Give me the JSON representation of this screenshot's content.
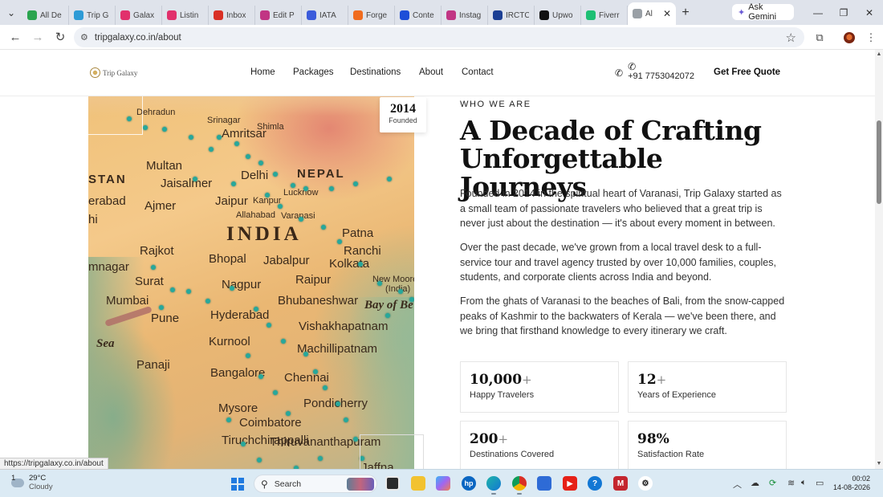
{
  "browser": {
    "tabs": [
      {
        "label": "All De",
        "color": "#2aa44f"
      },
      {
        "label": "Trip G",
        "color": "#2e9bd6"
      },
      {
        "label": "Galax",
        "color": "#e1306c"
      },
      {
        "label": "Listin",
        "color": "#e1306c"
      },
      {
        "label": "Inbox",
        "color": "#d93025"
      },
      {
        "label": "Edit P",
        "color": "#c13584"
      },
      {
        "label": "IATA",
        "color": "#3b5bdb"
      },
      {
        "label": "Forge",
        "color": "#f06c1f"
      },
      {
        "label": "Conte",
        "color": "#1d4ed8"
      },
      {
        "label": "Instag",
        "color": "#c13584"
      },
      {
        "label": "IRCTC",
        "color": "#1c3f94"
      },
      {
        "label": "Upwo",
        "color": "#111111"
      },
      {
        "label": "Fiverr",
        "color": "#1dbf73"
      },
      {
        "label": "Al",
        "color": "#9aa0a6"
      }
    ],
    "gemini_label": "Ask Gemini",
    "url": "tripgalaxy.co.in/about",
    "status_url": "https://tripgalaxy.co.in/about"
  },
  "site": {
    "logo_text": "Trip Galaxy",
    "nav": [
      "Home",
      "Packages",
      "Destinations",
      "About",
      "Contact"
    ],
    "phone": "+91 7753042072",
    "cta": "Get Free Quote",
    "founded_year": "2014",
    "founded_label": "Founded",
    "eyebrow": "WHO WE ARE",
    "headline": "A Decade of Crafting Unforgettable Journeys",
    "paragraphs": [
      "Founded in 2014 in the spiritual heart of Varanasi, Trip Galaxy started as a small team of passionate travelers who believed that a great trip is never just about the destination — it's about every moment in between.",
      "Over the past decade, we've grown from a local travel desk to a full-service tour and travel agency trusted by over 10,000 families, couples, students, and corporate clients across India and beyond.",
      "From the ghats of Varanasi to the beaches of Bali, from the snow-capped peaks of Kashmir to the backwaters of Kerala — we've been there, and we bring that firsthand knowledge to every itinerary we craft."
    ],
    "stats": [
      {
        "value": "10,000",
        "suffix": "+",
        "label": "Happy Travelers"
      },
      {
        "value": "12",
        "suffix": "+",
        "label": "Years of Experience"
      },
      {
        "value": "200",
        "suffix": "+",
        "label": "Destinations Covered"
      },
      {
        "value": "98%",
        "suffix": "",
        "label": "Satisfaction Rate"
      }
    ],
    "map_labels": [
      "Srinagar",
      "Amritsar",
      "Dehradun",
      "Shimla",
      "STAN",
      "Multan",
      "Jaisalmer",
      "Delhi",
      "NEPAL",
      "erabad",
      "Ajmer",
      "Jaipur",
      "Kanpur",
      "Lucknow",
      "Allahabad",
      "Varanasi",
      "hi",
      "INDIA",
      "Patna",
      "Ranchi",
      "Rajkot",
      "Bhopal",
      "Jabalpur",
      "Kolkata",
      "mnagar",
      "Surat",
      "Nagpur",
      "Raipur",
      "New Moore",
      "(India)",
      "Mumbai",
      "Bhubaneshwar",
      "Bay of Be",
      "Pune",
      "Hyderabad",
      "Vishakhapatnam",
      "Sea",
      "Kurnool",
      "Machillipatnam",
      "Panaji",
      "Bangalore",
      "Chennai",
      "Mysore",
      "Pondicherry",
      "Coimbatore",
      "Tiruchchirappalli",
      "Thiruvananthapuram",
      "Jaffna"
    ]
  },
  "taskbar": {
    "temperature": "29°C",
    "weather": "Cloudy",
    "weather_badge": "1",
    "search_placeholder": "Search",
    "time": "00:02",
    "date": "14-08-2026"
  }
}
